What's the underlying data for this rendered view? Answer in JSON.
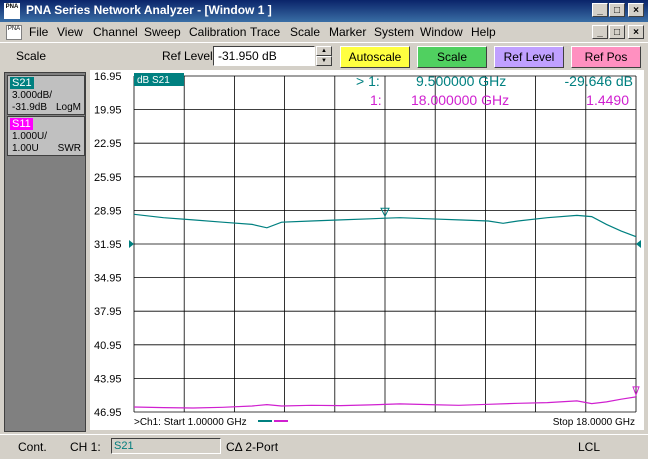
{
  "window": {
    "title": "PNA Series Network Analyzer - [Window 1 ]",
    "app_icon_text": "PNA",
    "controls": [
      "_",
      "□",
      "×"
    ]
  },
  "menubar": {
    "items": [
      "File",
      "View",
      "Channel",
      "Sweep",
      "Calibration",
      "Trace",
      "Scale",
      "Marker",
      "System",
      "Window",
      "Help"
    ],
    "doc_controls": [
      "_",
      "□",
      "×"
    ]
  },
  "toolbar": {
    "function_label": "Scale",
    "ref_level_label": "Ref Level",
    "ref_level_value": "-31.950 dB",
    "buttons": [
      {
        "label": "Autoscale",
        "color": "#ffff40"
      },
      {
        "label": "Scale",
        "color": "#50d060"
      },
      {
        "label": "Ref Level",
        "color": "#c0a0ff"
      },
      {
        "label": "Ref Pos",
        "color": "#ff90c0"
      }
    ]
  },
  "traces": [
    {
      "name": "S21",
      "line1": "3.000dB/",
      "line2": "-31.9dB",
      "format": "LogM",
      "color": "#008080",
      "bg": "#c0c0c0"
    },
    {
      "name": "S11",
      "line1": "1.000U/",
      "line2": "1.00U",
      "format": "SWR",
      "color": "#ff00ff",
      "bg": "#c0c0c0"
    }
  ],
  "colors": {
    "s21": "#008080",
    "s11": "#d020d0",
    "grid": "#000000"
  },
  "chart_data": {
    "type": "line",
    "ylabels": [
      "16.95",
      "19.95",
      "22.95",
      "25.95",
      "28.95",
      "31.95",
      "34.95",
      "37.95",
      "40.95",
      "43.95",
      "46.95"
    ],
    "trace_tag": "dB S21",
    "xlim": [
      1.0,
      18.0
    ],
    "x_unit": "GHz",
    "start_label": ">Ch1: Start  1.00000 GHz",
    "stop_label": "Stop  18.0000 GHz",
    "markers": [
      {
        "label": "> 1:",
        "freq": "9.500000 GHz",
        "value": "-29.646 dB",
        "color": "#008080"
      },
      {
        "label": "1:",
        "freq": "18.000000 GHz",
        "value": "1.4490",
        "color": "#d020d0"
      }
    ],
    "series": [
      {
        "name": "S21",
        "ylim": [
          -46.95,
          -16.95
        ],
        "x": [
          1.0,
          2.0,
          3.0,
          4.0,
          5.0,
          5.5,
          6.0,
          7.0,
          8.0,
          9.0,
          9.5,
          10.0,
          11.0,
          12.0,
          13.0,
          13.5,
          14.0,
          15.0,
          16.0,
          16.5,
          17.0,
          17.5,
          18.0
        ],
        "y": [
          -29.3,
          -29.6,
          -29.8,
          -30.0,
          -30.2,
          -30.5,
          -30.0,
          -29.9,
          -29.8,
          -29.7,
          -29.646,
          -29.6,
          -29.7,
          -29.8,
          -29.9,
          -30.1,
          -29.9,
          -29.6,
          -29.4,
          -29.5,
          -30.2,
          -30.8,
          -31.3
        ]
      },
      {
        "name": "S11",
        "ylim": [
          1.0,
          11.0
        ],
        "x": [
          1.0,
          2.0,
          3.0,
          4.0,
          5.0,
          5.5,
          6.0,
          7.0,
          8.0,
          9.0,
          10.0,
          11.0,
          12.0,
          13.0,
          14.0,
          15.0,
          16.0,
          16.5,
          17.0,
          17.5,
          18.0
        ],
        "y": [
          1.15,
          1.13,
          1.12,
          1.14,
          1.18,
          1.22,
          1.18,
          1.2,
          1.19,
          1.21,
          1.24,
          1.22,
          1.2,
          1.23,
          1.26,
          1.28,
          1.33,
          1.25,
          1.3,
          1.38,
          1.449
        ]
      }
    ]
  },
  "statusbar": {
    "mode": "Cont.",
    "channel": "CH 1:",
    "active_trace": "S21",
    "cal": "CΔ 2-Port",
    "remote": "LCL"
  }
}
